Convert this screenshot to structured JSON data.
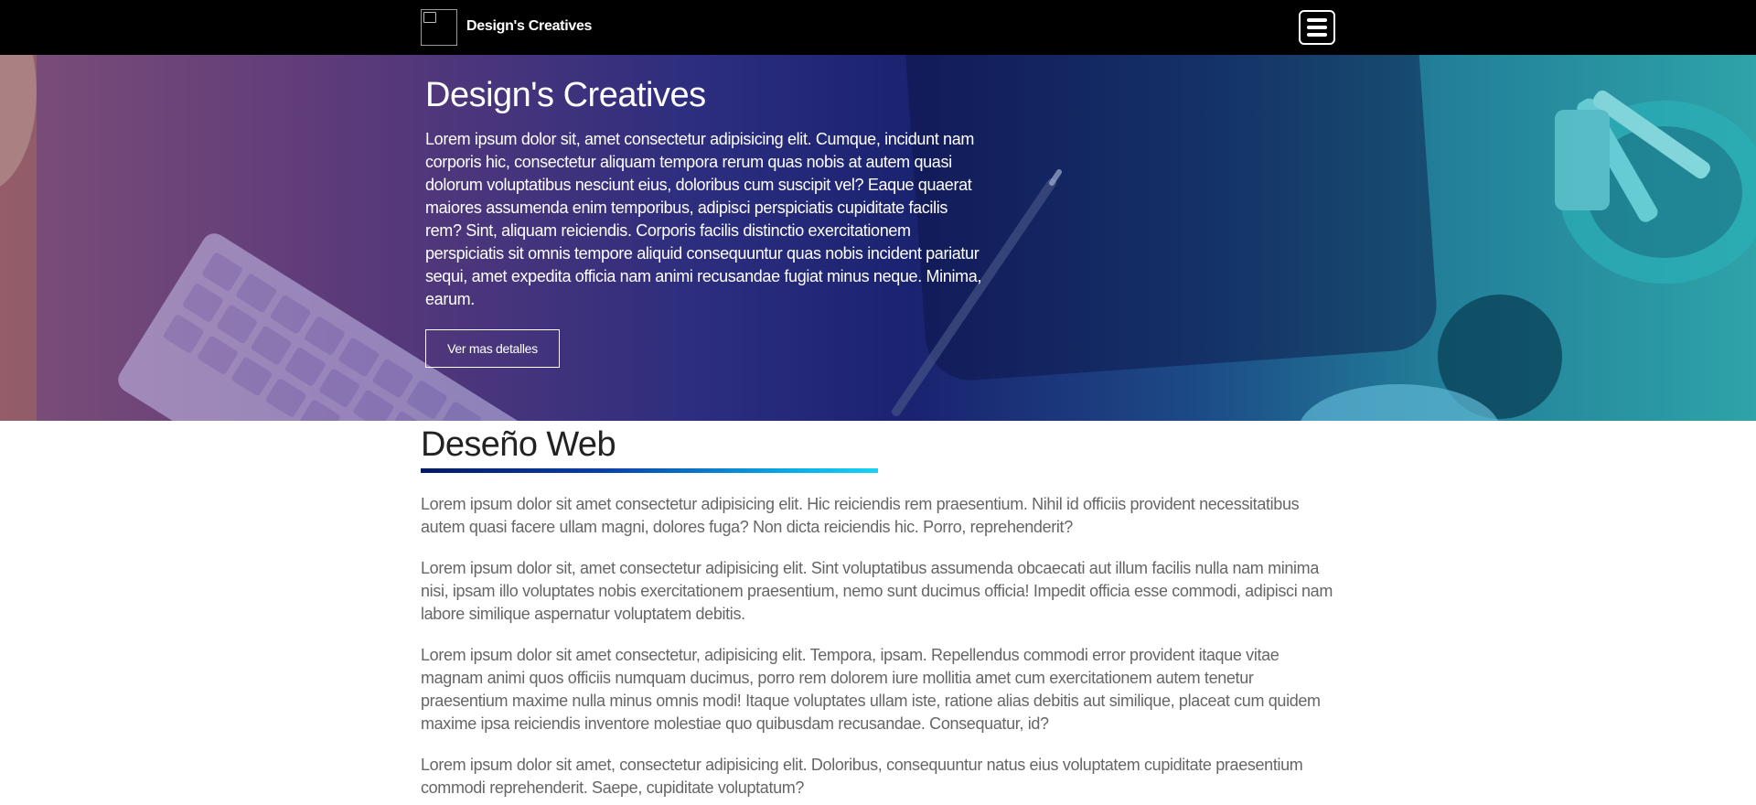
{
  "navbar": {
    "brand_name": "Design's Creatives",
    "logo_icon": "broken-image-icon",
    "menu_icon": "hamburger-menu-icon"
  },
  "hero": {
    "title": "Design's Creatives",
    "text": "Lorem ipsum dolor sit, amet consectetur adipisicing elit. Cumque, incidunt nam corporis hic, consectetur aliquam tempora rerum quas nobis at autem quasi dolorum voluptatibus nesciunt eius, doloribus cum suscipit vel? Eaque quaerat maiores assumenda enim temporibus, adipisci perspiciatis cupiditate facilis rem? Sint, aliquam reiciendis. Corporis facilis distinctio exercitationem perspiciatis sit omnis tempore aliquid consequuntur quas nobis incident pariatur sequi, amet expedita officia nam animi recusandae fugiat minus neque. Minima, earum.",
    "button_label": "Ver mas detalles"
  },
  "section": {
    "title": "Deseño Web",
    "paragraphs": [
      "Lorem ipsum dolor sit amet consectetur adipisicing elit. Hic reiciendis rem praesentium. Nihil id officiis provident necessitatibus autem quasi facere ullam magni, dolores fuga? Non dicta reiciendis hic. Porro, reprehenderit?",
      "Lorem ipsum dolor sit, amet consectetur adipisicing elit. Sint voluptatibus assumenda obcaecati aut illum facilis nulla nam minima nisi, ipsam illo voluptates nobis exercitationem praesentium, nemo sunt ducimus officia! Impedit officia esse commodi, adipisci nam labore similique aspernatur voluptatem debitis.",
      "Lorem ipsum dolor sit amet consectetur, adipisicing elit. Tempora, ipsam. Repellendus commodi error provident itaque vitae magnam animi quos officiis numquam ducimus, porro rem dolorem iure mollitia amet cum exercitationem autem tenetur praesentium maxime nulla minus omnis modi! Itaque voluptates ullam iste, ratione alias debitis aut similique, placeat cum quidem maxime ipsa reiciendis inventore molestiae quo quibusdam recusandae. Consequatur, id?",
      "Lorem ipsum dolor sit amet, consectetur adipisicing elit. Doloribus, consequuntur natus eius voluptatem cupiditate praesentium commodi reprehenderit. Saepe, cupiditate voluptatum?"
    ]
  },
  "colors": {
    "navbar_bg": "#000000",
    "hero_gradient_left": "#7d4e78",
    "hero_gradient_mid": "#1a2370",
    "hero_gradient_right": "#2ea3a8",
    "underline_start": "#001a66",
    "underline_end": "#17d4f5",
    "paragraph_text": "#666666"
  }
}
